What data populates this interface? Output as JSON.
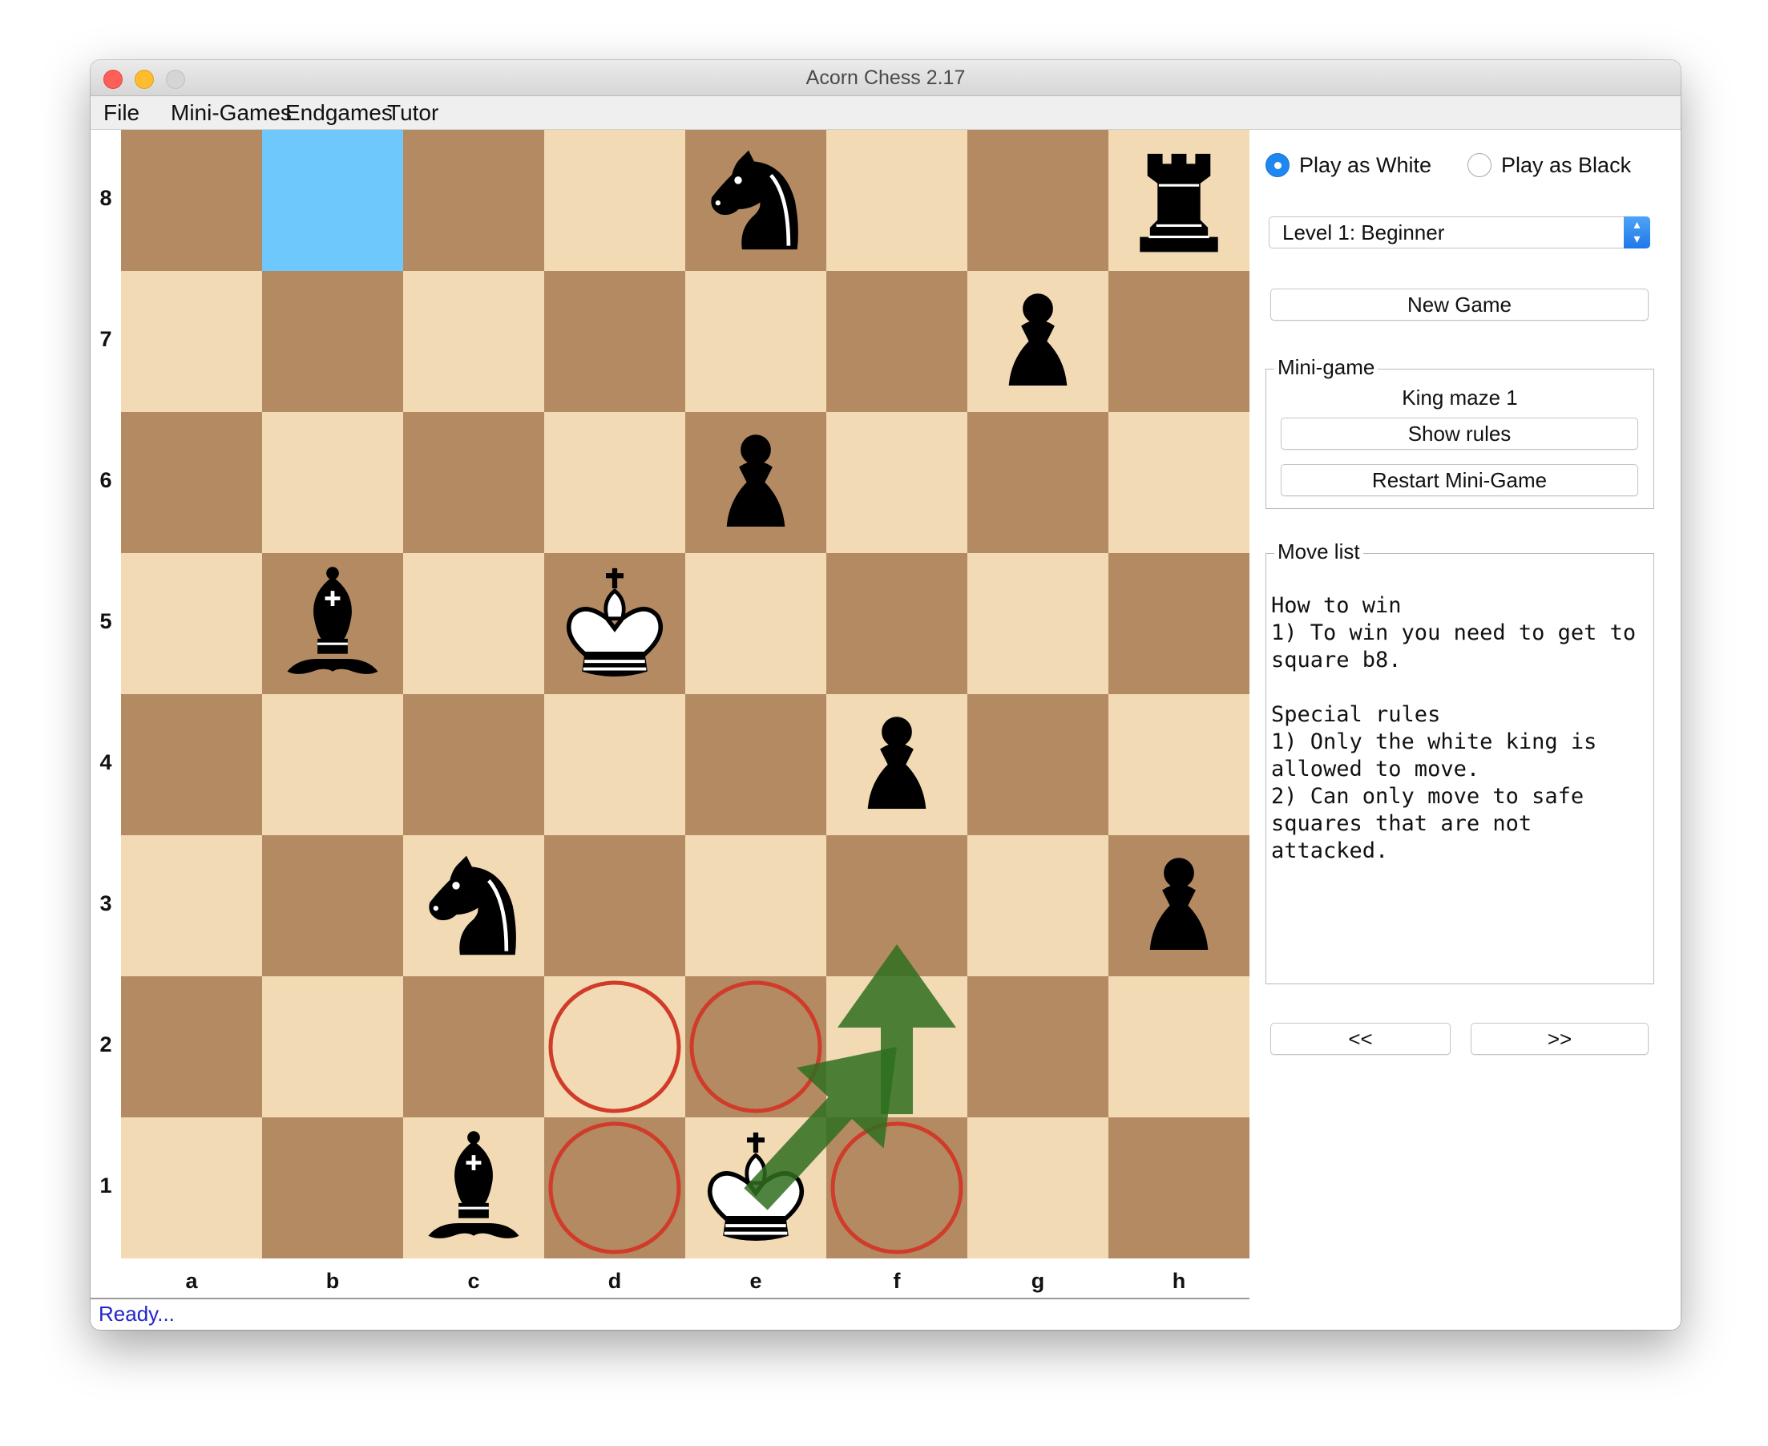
{
  "window": {
    "title": "Acorn Chess 2.17"
  },
  "menu": [
    "File",
    "Mini-Games",
    "Endgames",
    "Tutor"
  ],
  "board": {
    "ranks": [
      "8",
      "7",
      "6",
      "5",
      "4",
      "3",
      "2",
      "1"
    ],
    "files": [
      "a",
      "b",
      "c",
      "d",
      "e",
      "f",
      "g",
      "h"
    ],
    "colors": {
      "light": "#f2dab4",
      "dark": "#b48a63",
      "target": "#6ec8fb",
      "danger_marker": "#d03b2a",
      "arrow": "#2f6e1f"
    },
    "target_square": "b8",
    "pieces": [
      {
        "square": "e8",
        "piece": "black-knight"
      },
      {
        "square": "h8",
        "piece": "black-rook"
      },
      {
        "square": "g7",
        "piece": "black-pawn"
      },
      {
        "square": "e6",
        "piece": "black-pawn"
      },
      {
        "square": "b5",
        "piece": "black-bishop"
      },
      {
        "square": "d5",
        "piece": "white-king"
      },
      {
        "square": "f4",
        "piece": "black-pawn"
      },
      {
        "square": "c3",
        "piece": "black-knight"
      },
      {
        "square": "h3",
        "piece": "black-pawn"
      },
      {
        "square": "c1",
        "piece": "black-bishop"
      },
      {
        "square": "e1",
        "piece": "white-king"
      }
    ],
    "attacked_markers": [
      "d2",
      "e2",
      "d1",
      "f1"
    ],
    "hint_arrows": [
      {
        "from": "e1",
        "to": "f2"
      },
      {
        "from": "f2",
        "to": "f3"
      }
    ]
  },
  "status": "Ready...",
  "panel": {
    "play_white": "Play as White",
    "play_black": "Play as Black",
    "selected_side": "white",
    "level": "Level 1: Beginner",
    "new_game": "New Game",
    "minigame": {
      "group_title": "Mini-game",
      "name": "King maze 1",
      "show_rules": "Show rules",
      "restart": "Restart Mini-Game"
    },
    "movelist": {
      "group_title": "Move list",
      "text": "How to win\n1) To win you need to get to square b8.\n\nSpecial rules\n1) Only the white king is allowed to move.\n2) Can only move to safe squares that are not attacked."
    },
    "prev": "<<",
    "next": ">>"
  }
}
